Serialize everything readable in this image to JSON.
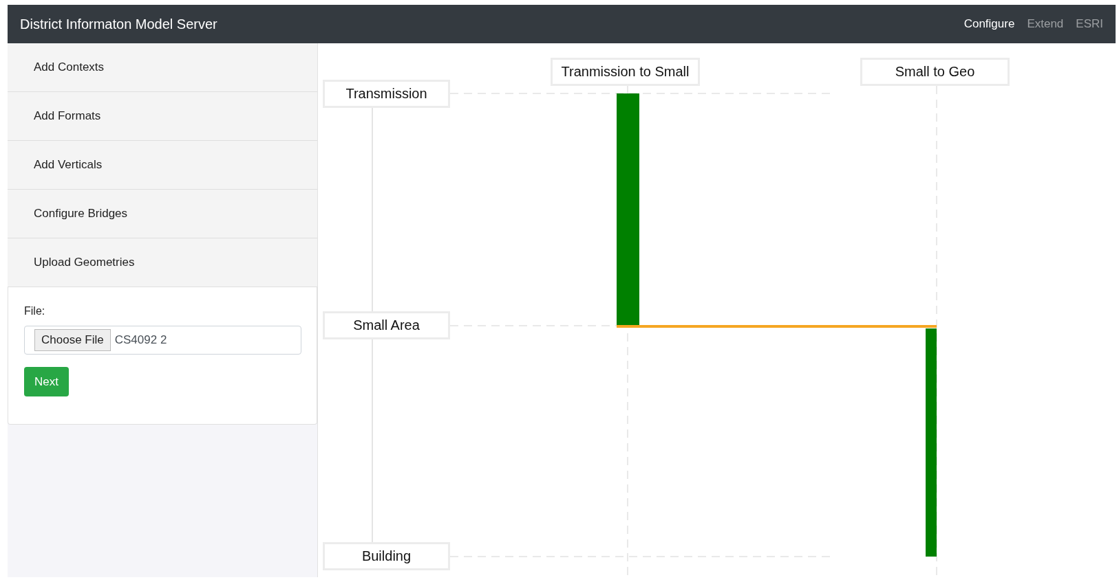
{
  "navbar": {
    "brand": "District Informaton Model Server",
    "links": [
      {
        "label": "Configure",
        "selected": true
      },
      {
        "label": "Extend",
        "selected": false
      },
      {
        "label": "ESRI",
        "selected": false
      }
    ]
  },
  "sidebar": {
    "items": [
      "Add Contexts",
      "Add Formats",
      "Add Verticals",
      "Configure Bridges",
      "Upload Geometries"
    ]
  },
  "form": {
    "label": "File:",
    "file_button": "Choose File",
    "file_name": "CS4092 2",
    "submit": "Next"
  },
  "diagram": {
    "levels": [
      "Transmission",
      "Small Area",
      "Building"
    ],
    "bridges": [
      "Tranmission to Small",
      "Small to Geo"
    ]
  }
}
